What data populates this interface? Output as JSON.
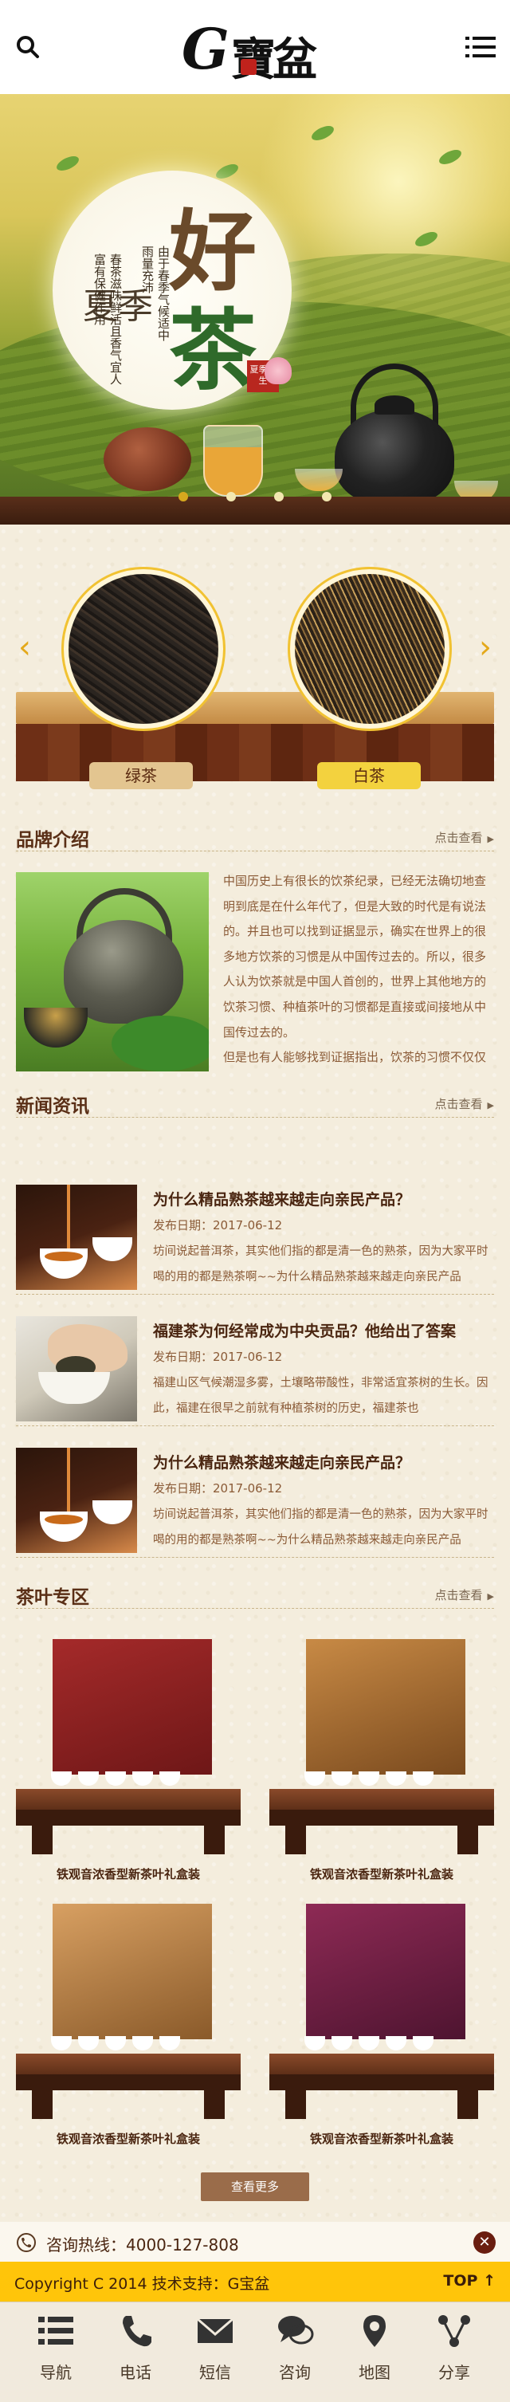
{
  "header": {
    "logo_letter": "G",
    "logo_text": "寶盆",
    "search_icon": "search-icon",
    "menu_icon": "menu-icon"
  },
  "banner": {
    "title_small": "夏季",
    "title_big_1": "好",
    "title_big_2": "茶",
    "vertical_1": "由于春季气候适中",
    "vertical_2": "雨量充沛",
    "vertical_3": "春茶滋味鲜活且香气宜人",
    "vertical_4": "富有保健作用",
    "stamp": "夏季养生",
    "slide_count": 4,
    "active_slide": 1
  },
  "tea_carousel": {
    "items": [
      {
        "label": "绿茶"
      },
      {
        "label": "白茶"
      }
    ],
    "accent": "#f1c232"
  },
  "brand": {
    "title": "品牌介绍",
    "more": "点击查看",
    "paragraph_1": "中国历史上有很长的饮茶纪录，已经无法确切地查明到底是在什么年代了，但是大致的时代是有说法的。并且也可以找到证据显示，确实在世界上的很多地方饮茶的习惯是从中国传过去的。所以，很多人认为饮茶就是中国人首创的，世界上其他地方的饮茶习惯、种植茶叶的习惯都是直接或间接地从中国传过去的。",
    "paragraph_2": "但是也有人能够找到证据指出，饮茶的习惯不仅仅是中国人发明的，在世界上的其他一些地方也"
  },
  "news": {
    "title": "新闻资讯",
    "more": "点击查看",
    "items": [
      {
        "title": "为什么精品熟茶越来越走向亲民产品？",
        "date": "发布日期：2017-06-12",
        "desc": "坊间说起普洱茶，其实他们指的都是清一色的熟茶，因为大家平时喝的用的都是熟茶啊~~为什么精品熟茶越来越走向亲民产品"
      },
      {
        "title": "福建茶为何经常成为中央贡品？他给出了答案",
        "date": "发布日期：2017-06-12",
        "desc": "福建山区气候潮湿多雾，土壤略带酸性，非常适宜茶树的生长。因此，福建在很早之前就有种植茶树的历史，福建茶也"
      },
      {
        "title": "为什么精品熟茶越来越走向亲民产品？",
        "date": "发布日期：2017-06-12",
        "desc": "坊间说起普洱茶，其实他们指的都是清一色的熟茶，因为大家平时喝的用的都是熟茶啊~~为什么精品熟茶越来越走向亲民产品"
      }
    ]
  },
  "products": {
    "title": "茶叶专区",
    "more": "点击查看",
    "items": [
      {
        "name": "铁观音浓香型新茶叶礼盒装",
        "color": "#8e1f1f"
      },
      {
        "name": "铁观音浓香型新茶叶礼盒装",
        "color": "#b47a3a"
      },
      {
        "name": "铁观音浓香型新茶叶礼盒装",
        "color": "#c69058"
      },
      {
        "name": "铁观音浓香型新茶叶礼盒装",
        "color": "#7a1e45"
      }
    ],
    "view_more": "查看更多"
  },
  "hotline": {
    "text": "咨询热线：4000-127-808"
  },
  "copyright": {
    "text": "Copyright C 2014 技术支持：G宝盆",
    "top_label": "TOP"
  },
  "bottom_nav": {
    "items": [
      {
        "label": "导航",
        "icon": "list-icon"
      },
      {
        "label": "电话",
        "icon": "phone-icon"
      },
      {
        "label": "短信",
        "icon": "mail-icon"
      },
      {
        "label": "咨询",
        "icon": "chat-icon"
      },
      {
        "label": "地图",
        "icon": "map-pin-icon"
      },
      {
        "label": "分享",
        "icon": "share-icon"
      }
    ]
  },
  "colors": {
    "brown": "#5a2f16",
    "gold": "#ffc50a",
    "button": "#9a6c4a"
  }
}
